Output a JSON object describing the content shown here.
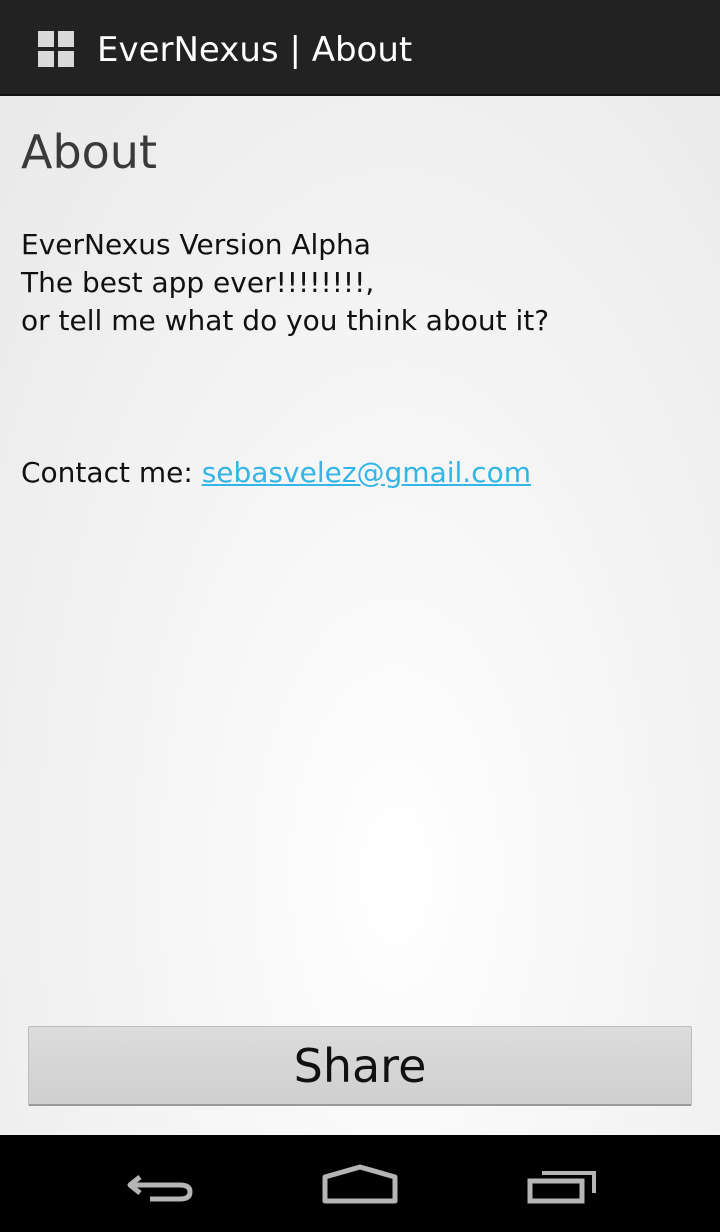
{
  "action_bar": {
    "icon": "grid-icon",
    "title": "EverNexus | About"
  },
  "main": {
    "heading": "About",
    "lines": [
      "EverNexus Version Alpha",
      "The best app ever!!!!!!!!,",
      "or tell me what do you think about it?"
    ],
    "contact_label": "Contact me: ",
    "contact_email": "sebasvelez@gmail.com",
    "link_color": "#33b5e5"
  },
  "share_button": {
    "label": "Share"
  },
  "nav_bar": {
    "back_icon": "back-icon",
    "home_icon": "home-icon",
    "recents_icon": "recent-apps-icon"
  }
}
